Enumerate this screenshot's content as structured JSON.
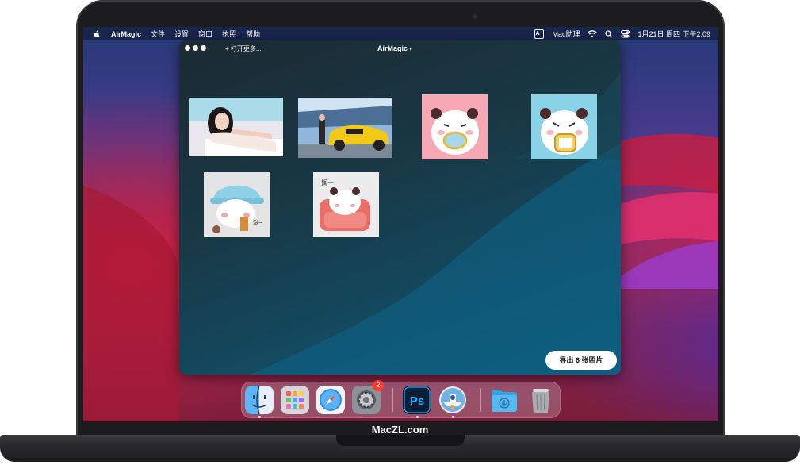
{
  "menubar": {
    "app_name": "AirMagic",
    "menus": [
      "文件",
      "设置",
      "窗口",
      "执照",
      "帮助"
    ],
    "input_method": "A",
    "assistant": "Mac助理",
    "datetime": "1月21日 周四 下午2:09"
  },
  "window": {
    "title": "AirMagic",
    "open_more": "+ 打开更多...",
    "export_label": "导出 6 张照片",
    "photos": [
      {
        "name": "photo-woman-portrait"
      },
      {
        "name": "photo-yellow-car"
      },
      {
        "name": "photo-panda-sticker-pink"
      },
      {
        "name": "photo-panda-sticker-blue"
      },
      {
        "name": "photo-panda-sticker-hat"
      },
      {
        "name": "photo-panda-sticker-sofa"
      }
    ]
  },
  "sticker_text": {
    "hat": "滋~",
    "sofa": "搁一"
  },
  "dock": {
    "apps": [
      "finder-icon",
      "launchpad-icon",
      "safari-icon",
      "system-preferences-icon",
      "photoshop-icon",
      "airmagic-icon",
      "downloads-folder-icon",
      "trash-icon"
    ],
    "system_preferences_badge": "2",
    "photoshop_label": "Ps"
  },
  "brand": "MacZL.com",
  "colors": {
    "bezel": "#1c1c1e",
    "window_accent": "#0f5a7a",
    "badge": "#ff3b30"
  }
}
